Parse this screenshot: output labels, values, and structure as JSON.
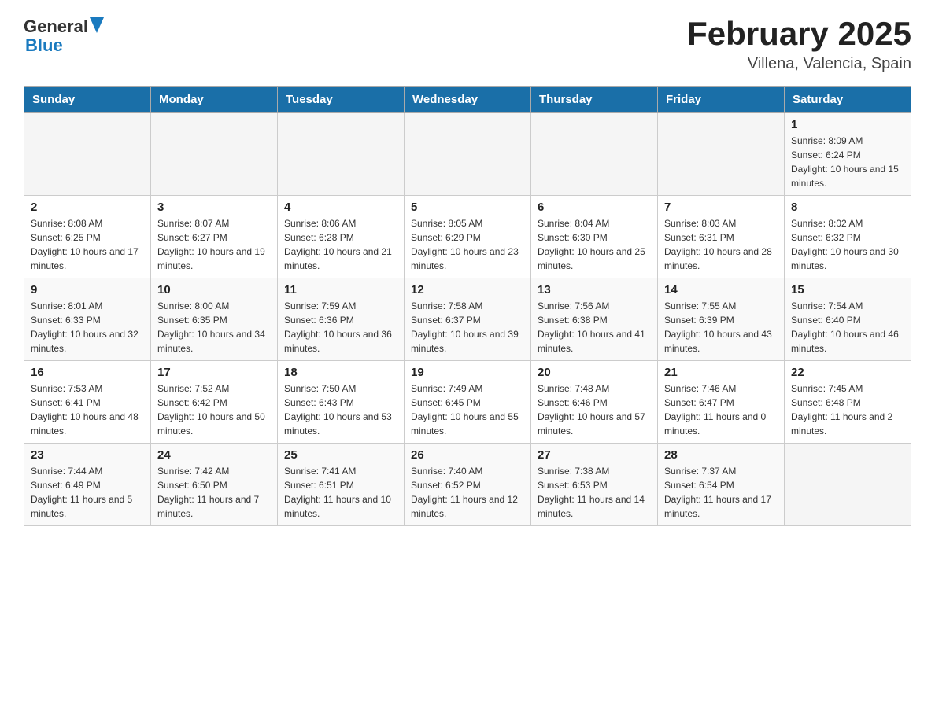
{
  "header": {
    "logo_general": "General",
    "logo_blue": "Blue",
    "month_title": "February 2025",
    "location": "Villena, Valencia, Spain"
  },
  "weekdays": [
    "Sunday",
    "Monday",
    "Tuesday",
    "Wednesday",
    "Thursday",
    "Friday",
    "Saturday"
  ],
  "weeks": [
    [
      {
        "day": "",
        "info": ""
      },
      {
        "day": "",
        "info": ""
      },
      {
        "day": "",
        "info": ""
      },
      {
        "day": "",
        "info": ""
      },
      {
        "day": "",
        "info": ""
      },
      {
        "day": "",
        "info": ""
      },
      {
        "day": "1",
        "info": "Sunrise: 8:09 AM\nSunset: 6:24 PM\nDaylight: 10 hours and 15 minutes."
      }
    ],
    [
      {
        "day": "2",
        "info": "Sunrise: 8:08 AM\nSunset: 6:25 PM\nDaylight: 10 hours and 17 minutes."
      },
      {
        "day": "3",
        "info": "Sunrise: 8:07 AM\nSunset: 6:27 PM\nDaylight: 10 hours and 19 minutes."
      },
      {
        "day": "4",
        "info": "Sunrise: 8:06 AM\nSunset: 6:28 PM\nDaylight: 10 hours and 21 minutes."
      },
      {
        "day": "5",
        "info": "Sunrise: 8:05 AM\nSunset: 6:29 PM\nDaylight: 10 hours and 23 minutes."
      },
      {
        "day": "6",
        "info": "Sunrise: 8:04 AM\nSunset: 6:30 PM\nDaylight: 10 hours and 25 minutes."
      },
      {
        "day": "7",
        "info": "Sunrise: 8:03 AM\nSunset: 6:31 PM\nDaylight: 10 hours and 28 minutes."
      },
      {
        "day": "8",
        "info": "Sunrise: 8:02 AM\nSunset: 6:32 PM\nDaylight: 10 hours and 30 minutes."
      }
    ],
    [
      {
        "day": "9",
        "info": "Sunrise: 8:01 AM\nSunset: 6:33 PM\nDaylight: 10 hours and 32 minutes."
      },
      {
        "day": "10",
        "info": "Sunrise: 8:00 AM\nSunset: 6:35 PM\nDaylight: 10 hours and 34 minutes."
      },
      {
        "day": "11",
        "info": "Sunrise: 7:59 AM\nSunset: 6:36 PM\nDaylight: 10 hours and 36 minutes."
      },
      {
        "day": "12",
        "info": "Sunrise: 7:58 AM\nSunset: 6:37 PM\nDaylight: 10 hours and 39 minutes."
      },
      {
        "day": "13",
        "info": "Sunrise: 7:56 AM\nSunset: 6:38 PM\nDaylight: 10 hours and 41 minutes."
      },
      {
        "day": "14",
        "info": "Sunrise: 7:55 AM\nSunset: 6:39 PM\nDaylight: 10 hours and 43 minutes."
      },
      {
        "day": "15",
        "info": "Sunrise: 7:54 AM\nSunset: 6:40 PM\nDaylight: 10 hours and 46 minutes."
      }
    ],
    [
      {
        "day": "16",
        "info": "Sunrise: 7:53 AM\nSunset: 6:41 PM\nDaylight: 10 hours and 48 minutes."
      },
      {
        "day": "17",
        "info": "Sunrise: 7:52 AM\nSunset: 6:42 PM\nDaylight: 10 hours and 50 minutes."
      },
      {
        "day": "18",
        "info": "Sunrise: 7:50 AM\nSunset: 6:43 PM\nDaylight: 10 hours and 53 minutes."
      },
      {
        "day": "19",
        "info": "Sunrise: 7:49 AM\nSunset: 6:45 PM\nDaylight: 10 hours and 55 minutes."
      },
      {
        "day": "20",
        "info": "Sunrise: 7:48 AM\nSunset: 6:46 PM\nDaylight: 10 hours and 57 minutes."
      },
      {
        "day": "21",
        "info": "Sunrise: 7:46 AM\nSunset: 6:47 PM\nDaylight: 11 hours and 0 minutes."
      },
      {
        "day": "22",
        "info": "Sunrise: 7:45 AM\nSunset: 6:48 PM\nDaylight: 11 hours and 2 minutes."
      }
    ],
    [
      {
        "day": "23",
        "info": "Sunrise: 7:44 AM\nSunset: 6:49 PM\nDaylight: 11 hours and 5 minutes."
      },
      {
        "day": "24",
        "info": "Sunrise: 7:42 AM\nSunset: 6:50 PM\nDaylight: 11 hours and 7 minutes."
      },
      {
        "day": "25",
        "info": "Sunrise: 7:41 AM\nSunset: 6:51 PM\nDaylight: 11 hours and 10 minutes."
      },
      {
        "day": "26",
        "info": "Sunrise: 7:40 AM\nSunset: 6:52 PM\nDaylight: 11 hours and 12 minutes."
      },
      {
        "day": "27",
        "info": "Sunrise: 7:38 AM\nSunset: 6:53 PM\nDaylight: 11 hours and 14 minutes."
      },
      {
        "day": "28",
        "info": "Sunrise: 7:37 AM\nSunset: 6:54 PM\nDaylight: 11 hours and 17 minutes."
      },
      {
        "day": "",
        "info": ""
      }
    ]
  ]
}
